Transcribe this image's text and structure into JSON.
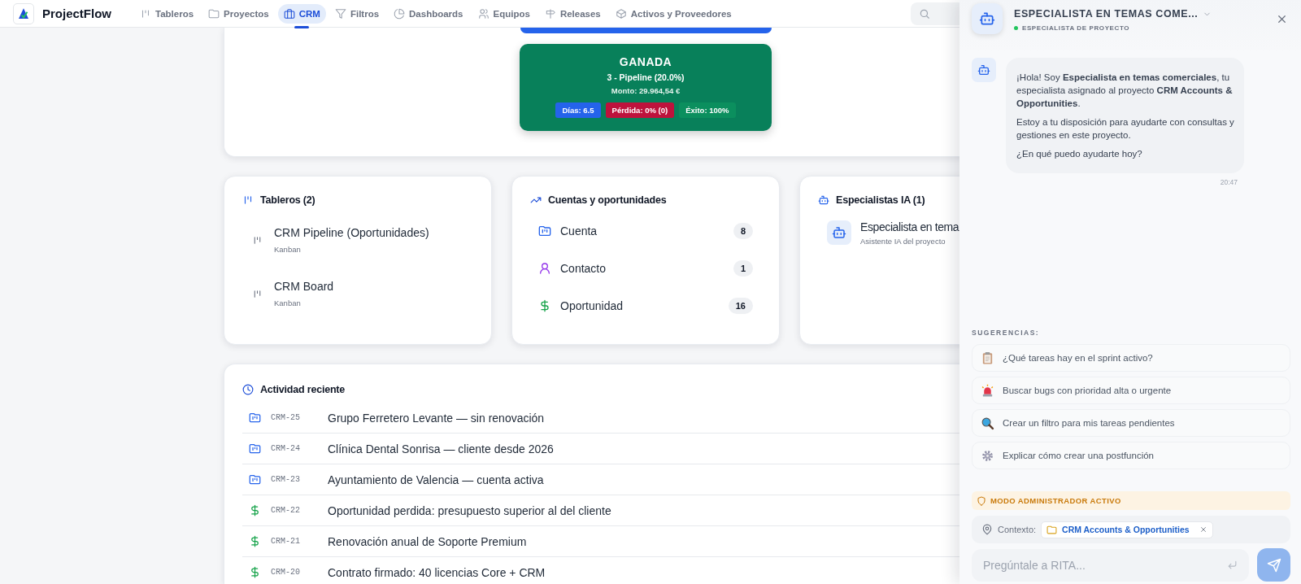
{
  "app": {
    "name": "ProjectFlow"
  },
  "nav": [
    {
      "label": "Tableros",
      "kind": "board",
      "selected": false
    },
    {
      "label": "Proyectos",
      "kind": "folder",
      "selected": false
    },
    {
      "label": "CRM",
      "kind": "briefcase",
      "selected": true
    },
    {
      "label": "Filtros",
      "kind": "filter",
      "selected": false
    },
    {
      "label": "Dashboards",
      "kind": "pie",
      "selected": false
    },
    {
      "label": "Equipos",
      "kind": "users",
      "selected": false
    },
    {
      "label": "Releases",
      "kind": "signpost",
      "selected": false
    },
    {
      "label": "Activos y Proveedores",
      "kind": "box",
      "selected": false
    }
  ],
  "pipeline": {
    "stage": "GANADA",
    "subtitle": "3 - Pipeline (20.0%)",
    "amount": "Monto: 29.964,54 €",
    "metrics": [
      {
        "label": "Días: 6.5",
        "color": "#2563eb"
      },
      {
        "label": "Pérdida: 0% (0)",
        "color": "#be123c"
      },
      {
        "label": "Éxito: 100%",
        "color": "#0b8f5e"
      }
    ]
  },
  "boards": {
    "title": "Tableros (2)",
    "items": [
      {
        "name": "CRM Pipeline (Oportunidades)",
        "type": "Kanban"
      },
      {
        "name": "CRM Board",
        "type": "Kanban"
      }
    ]
  },
  "accounts": {
    "title": "Cuentas y oportunidades",
    "items": [
      {
        "kind": "account",
        "label": "Cuenta",
        "count": "8"
      },
      {
        "kind": "contact",
        "label": "Contacto",
        "count": "1"
      },
      {
        "kind": "opportunity",
        "label": "Oportunidad",
        "count": "16"
      }
    ]
  },
  "specialists": {
    "title": "Especialistas IA (1)",
    "items": [
      {
        "name": "Especialista en tema",
        "subtitle": "Asistente IA del proyecto"
      }
    ]
  },
  "activity": {
    "title": "Actividad reciente",
    "items": [
      {
        "kind": "account",
        "key": "CRM-25",
        "summary": "Grupo Ferretero Levante — sin renovación"
      },
      {
        "kind": "account",
        "key": "CRM-24",
        "summary": "Clínica Dental Sonrisa — cliente desde 2026"
      },
      {
        "kind": "account",
        "key": "CRM-23",
        "summary": "Ayuntamiento de Valencia — cuenta activa"
      },
      {
        "kind": "opportunity",
        "key": "CRM-22",
        "summary": "Oportunidad perdida: presupuesto superior al del cliente"
      },
      {
        "kind": "opportunity",
        "key": "CRM-21",
        "summary": "Renovación anual de Soporte Premium"
      },
      {
        "kind": "opportunity",
        "key": "CRM-20",
        "summary": "Contrato firmado: 40 licencias Core + CRM"
      }
    ]
  },
  "chat": {
    "title": "ESPECIALISTA EN TEMAS COME...",
    "role": "ESPECIALISTA DE PROYECTO",
    "online": true,
    "messages": [
      {
        "paragraphs": [
          "¡Hola! Soy **Especialista en temas comerciales**, tu especialista asignado al proyecto **CRM Accounts & Opportunities**.",
          "Estoy a tu disposición para ayudarte con consultas y gestiones en este proyecto.",
          "¿En qué puedo ayudarte hoy?"
        ],
        "time": "20:47"
      }
    ],
    "suggestions_title": "SUGERENCIAS:",
    "suggestions": [
      {
        "kind": "clipboard",
        "text": "¿Qué tareas hay en el sprint activo?"
      },
      {
        "kind": "siren",
        "text": "Buscar bugs con prioridad alta o urgente"
      },
      {
        "kind": "magnifier",
        "text": "Crear un filtro para mis tareas pendientes"
      },
      {
        "kind": "gear",
        "text": "Explicar cómo crear una postfunción"
      }
    ],
    "admin_banner": "MODO ADMINISTRADOR ACTIVO",
    "context": {
      "label": "Contexto:",
      "chip": "CRM Accounts & Opportunities"
    },
    "input": {
      "placeholder": "Pregúntale a RITA..."
    }
  }
}
